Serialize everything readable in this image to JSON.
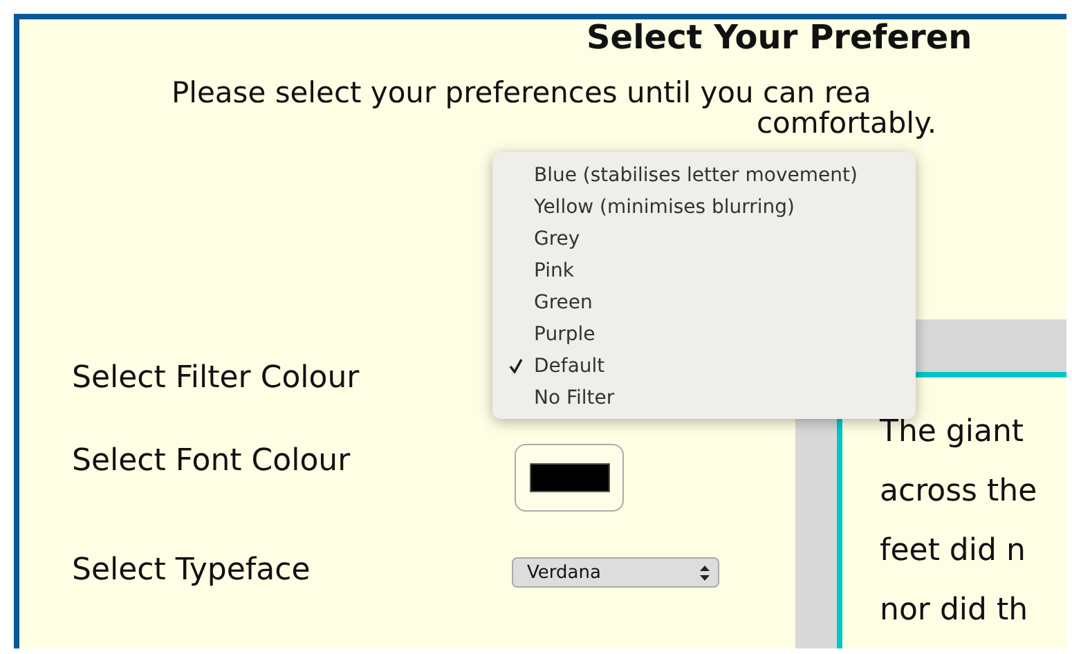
{
  "heading": "Select Your Preferen",
  "intro": [
    "Please select your preferences until you can rea",
    "comfortably."
  ],
  "settings": [
    {
      "kind": "filter",
      "label": "Select Filter Colour"
    },
    {
      "kind": "swatch",
      "label": "Select Font Colour",
      "color": "#000000"
    },
    {
      "kind": "select",
      "label": "Select Typeface",
      "value": "Verdana"
    }
  ],
  "filter_menu": [
    {
      "label": "Blue (stabilises letter movement)",
      "selected": false
    },
    {
      "label": "Yellow (minimises blurring)",
      "selected": false
    },
    {
      "label": "Grey",
      "selected": false
    },
    {
      "label": "Pink",
      "selected": false
    },
    {
      "label": "Green",
      "selected": false
    },
    {
      "label": "Purple",
      "selected": false
    },
    {
      "label": "Default",
      "selected": true
    },
    {
      "label": "No Filter",
      "selected": false
    }
  ],
  "preview_lines": [
    "The giant",
    "across the",
    "feet did n",
    "nor did th"
  ]
}
